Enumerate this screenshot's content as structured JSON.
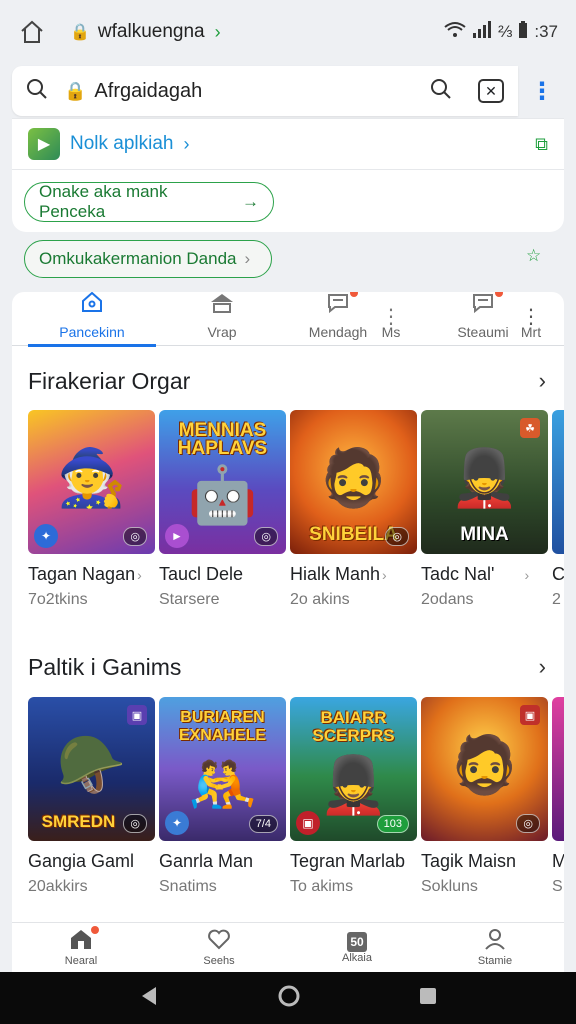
{
  "status_bar": {
    "url": "wfalkuengna",
    "time": ":37",
    "battery_label": "⅔"
  },
  "address_bar": {
    "url": "Afrgaidagah"
  },
  "bookmark": {
    "label": "Nolk aplkiah"
  },
  "suggestions": [
    {
      "label": "Onake aka mank Penceka"
    },
    {
      "label": "Omkukakermanion Danda"
    }
  ],
  "tabs": [
    {
      "label": "Pancekinn",
      "icon": "home-icon",
      "active": true
    },
    {
      "label": "Vrap",
      "icon": "upload-icon"
    },
    {
      "label": "Mendagh",
      "icon": "chat-icon"
    },
    {
      "label": "Ms",
      "icon": "more-icon"
    },
    {
      "label": "Steaumi",
      "icon": "chat-icon"
    },
    {
      "label": "Mrt",
      "icon": "more-icon"
    }
  ],
  "sections": [
    {
      "title": "Firakeriar Orgar",
      "games": [
        {
          "name": "Tagan Nagan",
          "sub": "7o2tkins",
          "art_text": "",
          "badge": ""
        },
        {
          "name": "Taucl Dele",
          "sub": "Starsere",
          "art_text": "MENNIAS HAPLAVS",
          "badge": ""
        },
        {
          "name": "Hialk Manh",
          "sub": "2o akins",
          "art_text": "SNIBEILA",
          "badge": ""
        },
        {
          "name": "Tadc Nal'",
          "sub": "2odans",
          "art_text": "MINA",
          "badge": ""
        },
        {
          "name": "C",
          "sub": "2",
          "art_text": "",
          "badge": ""
        }
      ]
    },
    {
      "title": "Paltik i Ganims",
      "games": [
        {
          "name": "Gangia Gaml",
          "sub": "20akkirs",
          "art_text": "SMREDN",
          "badge": ""
        },
        {
          "name": "Ganrla Man",
          "sub": "Snatims",
          "art_text": "BURIAREN EXNAHELE",
          "badge": "7/4"
        },
        {
          "name": "Tegran Marlab",
          "sub": "To akims",
          "art_text": "BAIARR SCERPRS",
          "badge": "103"
        },
        {
          "name": "Tagik Maisn",
          "sub": "Sokluns",
          "art_text": "",
          "badge": ""
        },
        {
          "name": "M",
          "sub": "S",
          "art_text": "",
          "badge": ""
        }
      ]
    }
  ],
  "bottom_nav": [
    {
      "label": "Nearal",
      "icon": "home-icon"
    },
    {
      "label": "Seehs",
      "icon": "heart-icon"
    },
    {
      "label": "Alkaia",
      "icon": "grid-icon",
      "icon_text": "50"
    },
    {
      "label": "Stamie",
      "icon": "person-icon"
    }
  ],
  "colors": {
    "accent": "#1a73e8",
    "green": "#1e9e3c",
    "chip_text": "#1a7a33"
  }
}
